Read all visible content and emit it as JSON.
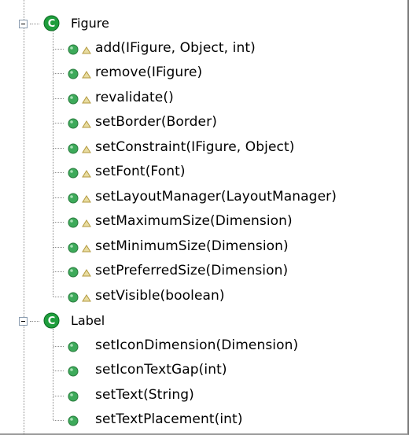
{
  "tree": {
    "groups": [
      {
        "class_name": "Figure",
        "class_icon": "class-c-icon",
        "expanded": true,
        "methods": [
          {
            "signature": "add(IFigure, Object, int)",
            "icon": "public-method-icon",
            "modifier_icon": "protected-triangle-icon"
          },
          {
            "signature": "remove(IFigure)",
            "icon": "public-method-icon",
            "modifier_icon": "protected-triangle-icon"
          },
          {
            "signature": "revalidate()",
            "icon": "public-method-icon",
            "modifier_icon": "protected-triangle-icon"
          },
          {
            "signature": "setBorder(Border)",
            "icon": "public-method-icon",
            "modifier_icon": "protected-triangle-icon"
          },
          {
            "signature": "setConstraint(IFigure, Object)",
            "icon": "public-method-icon",
            "modifier_icon": "protected-triangle-icon"
          },
          {
            "signature": "setFont(Font)",
            "icon": "public-method-icon",
            "modifier_icon": "protected-triangle-icon"
          },
          {
            "signature": "setLayoutManager(LayoutManager)",
            "icon": "public-method-icon",
            "modifier_icon": "protected-triangle-icon"
          },
          {
            "signature": "setMaximumSize(Dimension)",
            "icon": "public-method-icon",
            "modifier_icon": "protected-triangle-icon"
          },
          {
            "signature": "setMinimumSize(Dimension)",
            "icon": "public-method-icon",
            "modifier_icon": "protected-triangle-icon"
          },
          {
            "signature": "setPreferredSize(Dimension)",
            "icon": "public-method-icon",
            "modifier_icon": "protected-triangle-icon"
          },
          {
            "signature": "setVisible(boolean)",
            "icon": "public-method-icon",
            "modifier_icon": "protected-triangle-icon"
          }
        ]
      },
      {
        "class_name": "Label",
        "class_icon": "class-c-icon",
        "expanded": true,
        "methods": [
          {
            "signature": "setIconDimension(Dimension)",
            "icon": "public-method-icon",
            "modifier_icon": ""
          },
          {
            "signature": "setIconTextGap(int)",
            "icon": "public-method-icon",
            "modifier_icon": ""
          },
          {
            "signature": "setText(String)",
            "icon": "public-method-icon",
            "modifier_icon": ""
          },
          {
            "signature": "setTextPlacement(int)",
            "icon": "public-method-icon",
            "modifier_icon": ""
          }
        ]
      }
    ]
  },
  "colors": {
    "class_icon_fill": "#1f9e3d",
    "method_icon_fill": "#3daa5a",
    "triangle_fill": "#c8b46a",
    "tree_line": "#8c8c8c"
  }
}
